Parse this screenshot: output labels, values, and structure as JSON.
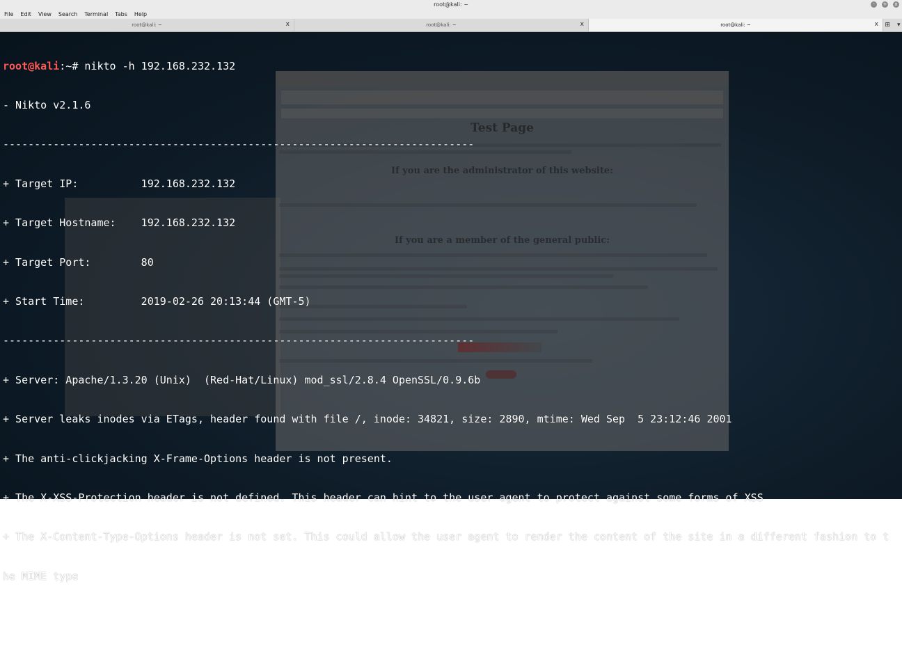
{
  "window": {
    "title": "root@kali: ~",
    "buttons": [
      "-",
      "+",
      "x"
    ]
  },
  "menu": [
    "File",
    "Edit",
    "View",
    "Search",
    "Terminal",
    "Tabs",
    "Help"
  ],
  "tabs": [
    {
      "label": "root@kali: ~",
      "close": "x"
    },
    {
      "label": "root@kali: ~",
      "close": "x"
    },
    {
      "label": "root@kali: ~",
      "close": "x"
    }
  ],
  "tab_tools": {
    "new_tab": "⊞",
    "menu": "▾"
  },
  "background_browser": {
    "title": "Test Page",
    "heading_admin": "If you are the administrator of this website:",
    "heading_member": "If you are a member of the general public:"
  },
  "terminal": {
    "prompt_user": "root@kali",
    "prompt_rest": ":~# ",
    "command": "nikto -h 192.168.232.132",
    "lines": [
      "- Nikto v2.1.6",
      "---------------------------------------------------------------------------",
      "+ Target IP:          192.168.232.132",
      "+ Target Hostname:    192.168.232.132",
      "+ Target Port:        80",
      "+ Start Time:         2019-02-26 20:13:44 (GMT-5)",
      "---------------------------------------------------------------------------",
      "+ Server: Apache/1.3.20 (Unix)  (Red-Hat/Linux) mod_ssl/2.8.4 OpenSSL/0.9.6b",
      "+ Server leaks inodes via ETags, header found with file /, inode: 34821, size: 2890, mtime: Wed Sep  5 23:12:46 2001",
      "+ The anti-clickjacking X-Frame-Options header is not present.",
      "+ The X-XSS-Protection header is not defined. This header can hint to the user agent to protect against some forms of XSS",
      "+ The X-Content-Type-Options header is not set. This could allow the user agent to render the content of the site in a different fashion to t",
      "he MIME type"
    ]
  }
}
